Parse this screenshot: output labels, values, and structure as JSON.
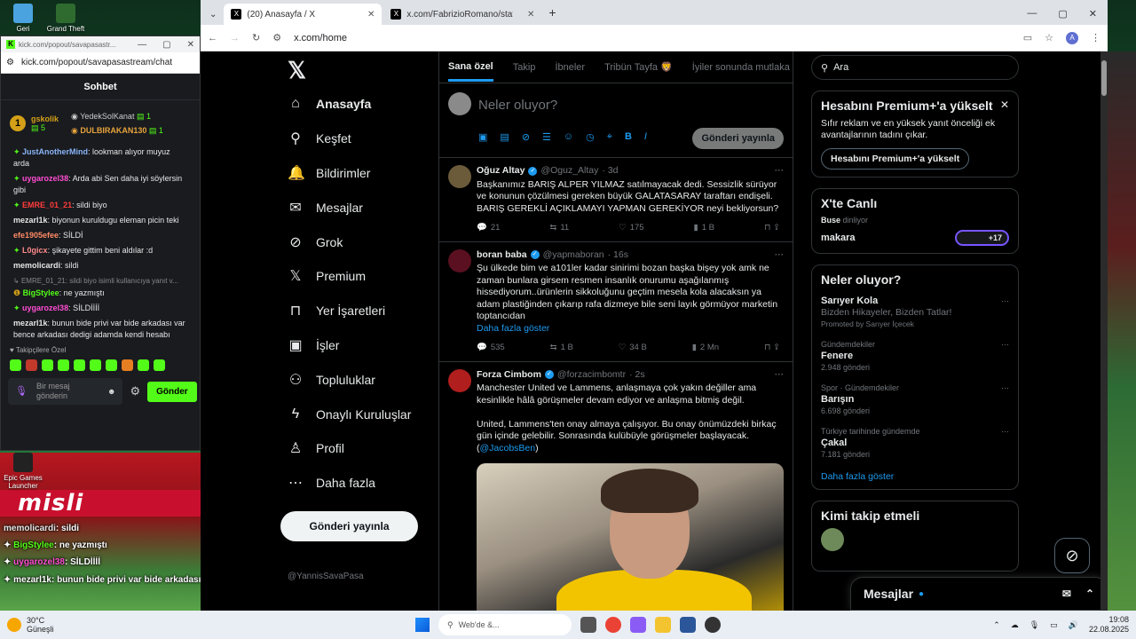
{
  "desktop": {
    "icons": [
      {
        "label": "Geri",
        "color": "#4aa3df"
      },
      {
        "label": "Grand Theft",
        "color": "#2f6b2f"
      },
      {
        "label": "Epic Games Launcher",
        "color": "#222222"
      }
    ],
    "overlay_chat": [
      {
        "user": "memolicardi",
        "text": ": sildi",
        "color": "#e6e6e6"
      },
      {
        "user": "BigStylee",
        "text": ": ne yazmıştı",
        "color": "#53fc18"
      },
      {
        "user": "uygarozel38",
        "text": ": SİLDİİİİ",
        "color": "#ff4dd2"
      },
      {
        "user": "mezarl1k",
        "text": ": bunun bide privi var bide arkadası var bence arkadası dedigi adamda kendi hesabı",
        "color": "#e6e6e6"
      }
    ]
  },
  "kick": {
    "window_url_short": "kick.com/popout/savapasastr...",
    "url": "kick.com/popout/savapasastream/chat",
    "title": "Sohbet",
    "leaders": [
      {
        "name": "gskolik",
        "count": "5",
        "rank": "1"
      },
      {
        "name": "YedekSolKanat",
        "count": "1"
      },
      {
        "name": "DULBIRAKAN130",
        "count": "1"
      }
    ],
    "messages": [
      {
        "user": "JustAnotherMind",
        "text": ": lookman alıyor muyuz arda",
        "color": "#8ab4f8"
      },
      {
        "user": "uygarozel38",
        "text": ": Arda abi Sen daha iyi söylersin gibi",
        "color": "#ff4dd2"
      },
      {
        "user": "EMRE_01_21",
        "text": ": sildi biyo",
        "color": "#ff3b3b"
      },
      {
        "user": "mezarl1k",
        "text": ": biyonun kuruldugu eleman picin teki",
        "color": "#e6e6e6"
      },
      {
        "user": "efe1905efee",
        "text": ": SİLDİ",
        "color": "#ff8a65"
      },
      {
        "user": "L0gicx",
        "text": ": şikayete gittim beni aldılar :d",
        "color": "#ff8a8a"
      },
      {
        "user": "memolicardi",
        "text": ": sildi",
        "color": "#e6e6e6"
      },
      {
        "user": "EMRE_01_21",
        "text": ": sildi biyo isimli kullanıcıya yanıt v...",
        "color": "#888888",
        "reply": true
      },
      {
        "user": "BigStylee",
        "text": ": ne yazmıştı",
        "color": "#53fc18"
      },
      {
        "user": "uygarozel38",
        "text": ": SİLDİİİİ",
        "color": "#ff4dd2"
      },
      {
        "user": "mezarl1k",
        "text": ": bunun bide privi var bide arkadası var bence arkadası dedigi adamda kendi hesabı",
        "color": "#e6e6e6"
      }
    ],
    "emote_label": "Takipçilere Özel",
    "input_placeholder": "Bir mesaj gönderin",
    "send_label": "Gönder"
  },
  "browser": {
    "tabs": [
      {
        "title": "(20) Anasayfa / X",
        "active": true
      },
      {
        "title": "x.com/FabrizioRomano/status/",
        "active": false
      }
    ],
    "url": "x.com/home",
    "profile_initial": "A"
  },
  "x": {
    "nav": [
      {
        "label": "Anasayfa",
        "icon": "home-icon",
        "glyph": "⌂",
        "active": true
      },
      {
        "label": "Keşfet",
        "icon": "search-icon",
        "glyph": "⚲"
      },
      {
        "label": "Bildirimler",
        "icon": "bell-icon",
        "glyph": "🔔"
      },
      {
        "label": "Mesajlar",
        "icon": "mail-icon",
        "glyph": "✉"
      },
      {
        "label": "Grok",
        "icon": "grok-icon",
        "glyph": "⊘"
      },
      {
        "label": "Premium",
        "icon": "x-logo-icon",
        "glyph": "𝕏"
      },
      {
        "label": "Yer İşaretleri",
        "icon": "bookmark-icon",
        "glyph": "⊓"
      },
      {
        "label": "İşler",
        "icon": "briefcase-icon",
        "glyph": "▣"
      },
      {
        "label": "Topluluklar",
        "icon": "people-icon",
        "glyph": "⚇"
      },
      {
        "label": "Onaylı Kuruluşlar",
        "icon": "lightning-icon",
        "glyph": "ϟ"
      },
      {
        "label": "Profil",
        "icon": "person-icon",
        "glyph": "♙"
      },
      {
        "label": "Daha fazla",
        "icon": "more-icon",
        "glyph": "⋯"
      }
    ],
    "post_button": "Gönderi yayınla",
    "account_handle": "@YannisSavaPasa",
    "feed_tabs": [
      "Sana özel",
      "Takip",
      "İbneler",
      "Tribün Tayfa 🦁",
      "İyiler sonunda mutlaka kaz"
    ],
    "compose_placeholder": "Neler oluyor?",
    "compose_button": "Gönderi yayınla",
    "tweets": [
      {
        "name": "Oğuz Altay",
        "handle": "@Oguz_Altay",
        "time": "· 3d",
        "avatar": "#6b5b3a",
        "text": "Başkanımız BARIŞ ALPER YILMAZ satılmayacak dedi. Sessizlik sürüyor ve konunun çözülmesi gereken büyük GALATASARAY taraftarı endişeli. BARIŞ GEREKLİ AÇIKLAMAYI YAPMAN GEREKİYOR neyi bekliyorsun?",
        "more": "",
        "replies": "21",
        "reposts": "11",
        "likes": "175",
        "views": "1 B"
      },
      {
        "name": "boran baba",
        "handle": "@yapmaboran",
        "time": "· 16s",
        "avatar": "#5a1020",
        "text": "Şu ülkede bim ve a101ler kadar sinirimi bozan başka bişey yok amk ne zaman bunlara girsem resmen insanlık onurumu aşağılanmış hissediyorum..ürünlerin sikkoluğunu geçtim mesela kola alacaksın ya adam plastiğinden çıkarıp rafa dizmeye bile seni layık görmüyor marketin toptancıdan",
        "more": "Daha fazla göster",
        "replies": "535",
        "reposts": "1 B",
        "likes": "34 B",
        "views": "2 Mn"
      },
      {
        "name": "Forza Cimbom",
        "handle": "@forzacimbomtr",
        "time": "· 2s",
        "avatar": "#b01e1e",
        "text": "Manchester United ve Lammens, anlaşmaya çok yakın değiller ama kesinlikle hâlâ görüşmeler devam ediyor ve anlaşma bitmiş değil.\n\nUnited, Lammens'ten onay almaya çalışıyor. Bu onay önümüzdeki birkaç gün içinde gelebilir. Sonrasında kulübüyle görüşmeler başlayacak. (",
        "mention": "@JacobsBen",
        "close": ")"
      }
    ],
    "search_placeholder": "Ara",
    "premium": {
      "title": "Hesabını Premium+'a yükselt",
      "text": "Sıfır reklam ve en yüksek yanıt önceliği ek avantajlarının tadını çıkar.",
      "button": "Hesabını Premium+'a yükselt"
    },
    "live": {
      "title": "X'te Canlı",
      "host": "Buse",
      "status": "dinliyor",
      "topic": "makara",
      "count": "+17"
    },
    "trends": {
      "title": "Neler oluyor?",
      "items": [
        {
          "context": "",
          "name": "Sarıyer Kola",
          "sub": "Bizden Hikayeler, Bizden Tatlar!",
          "extra": "Promoted by Sarıyer İçecek"
        },
        {
          "context": "Gündemdekiler",
          "name": "Fenere",
          "sub": "2.948 gönderi"
        },
        {
          "context": "Spor · Gündemdekiler",
          "name": "Barışın",
          "sub": "6.698 gönderi"
        },
        {
          "context": "Türkiye tarihinde gündemde",
          "name": "Çakal",
          "sub": "7.181 gönderi"
        }
      ],
      "more": "Daha fazla göster"
    },
    "who_to_follow": "Kimi takip etmeli",
    "dm_title": "Mesajlar"
  },
  "taskbar": {
    "temp": "30°C",
    "weather": "Güneşli",
    "search": "Web'de &...",
    "time": "19:08",
    "date": "22.08.2025"
  }
}
